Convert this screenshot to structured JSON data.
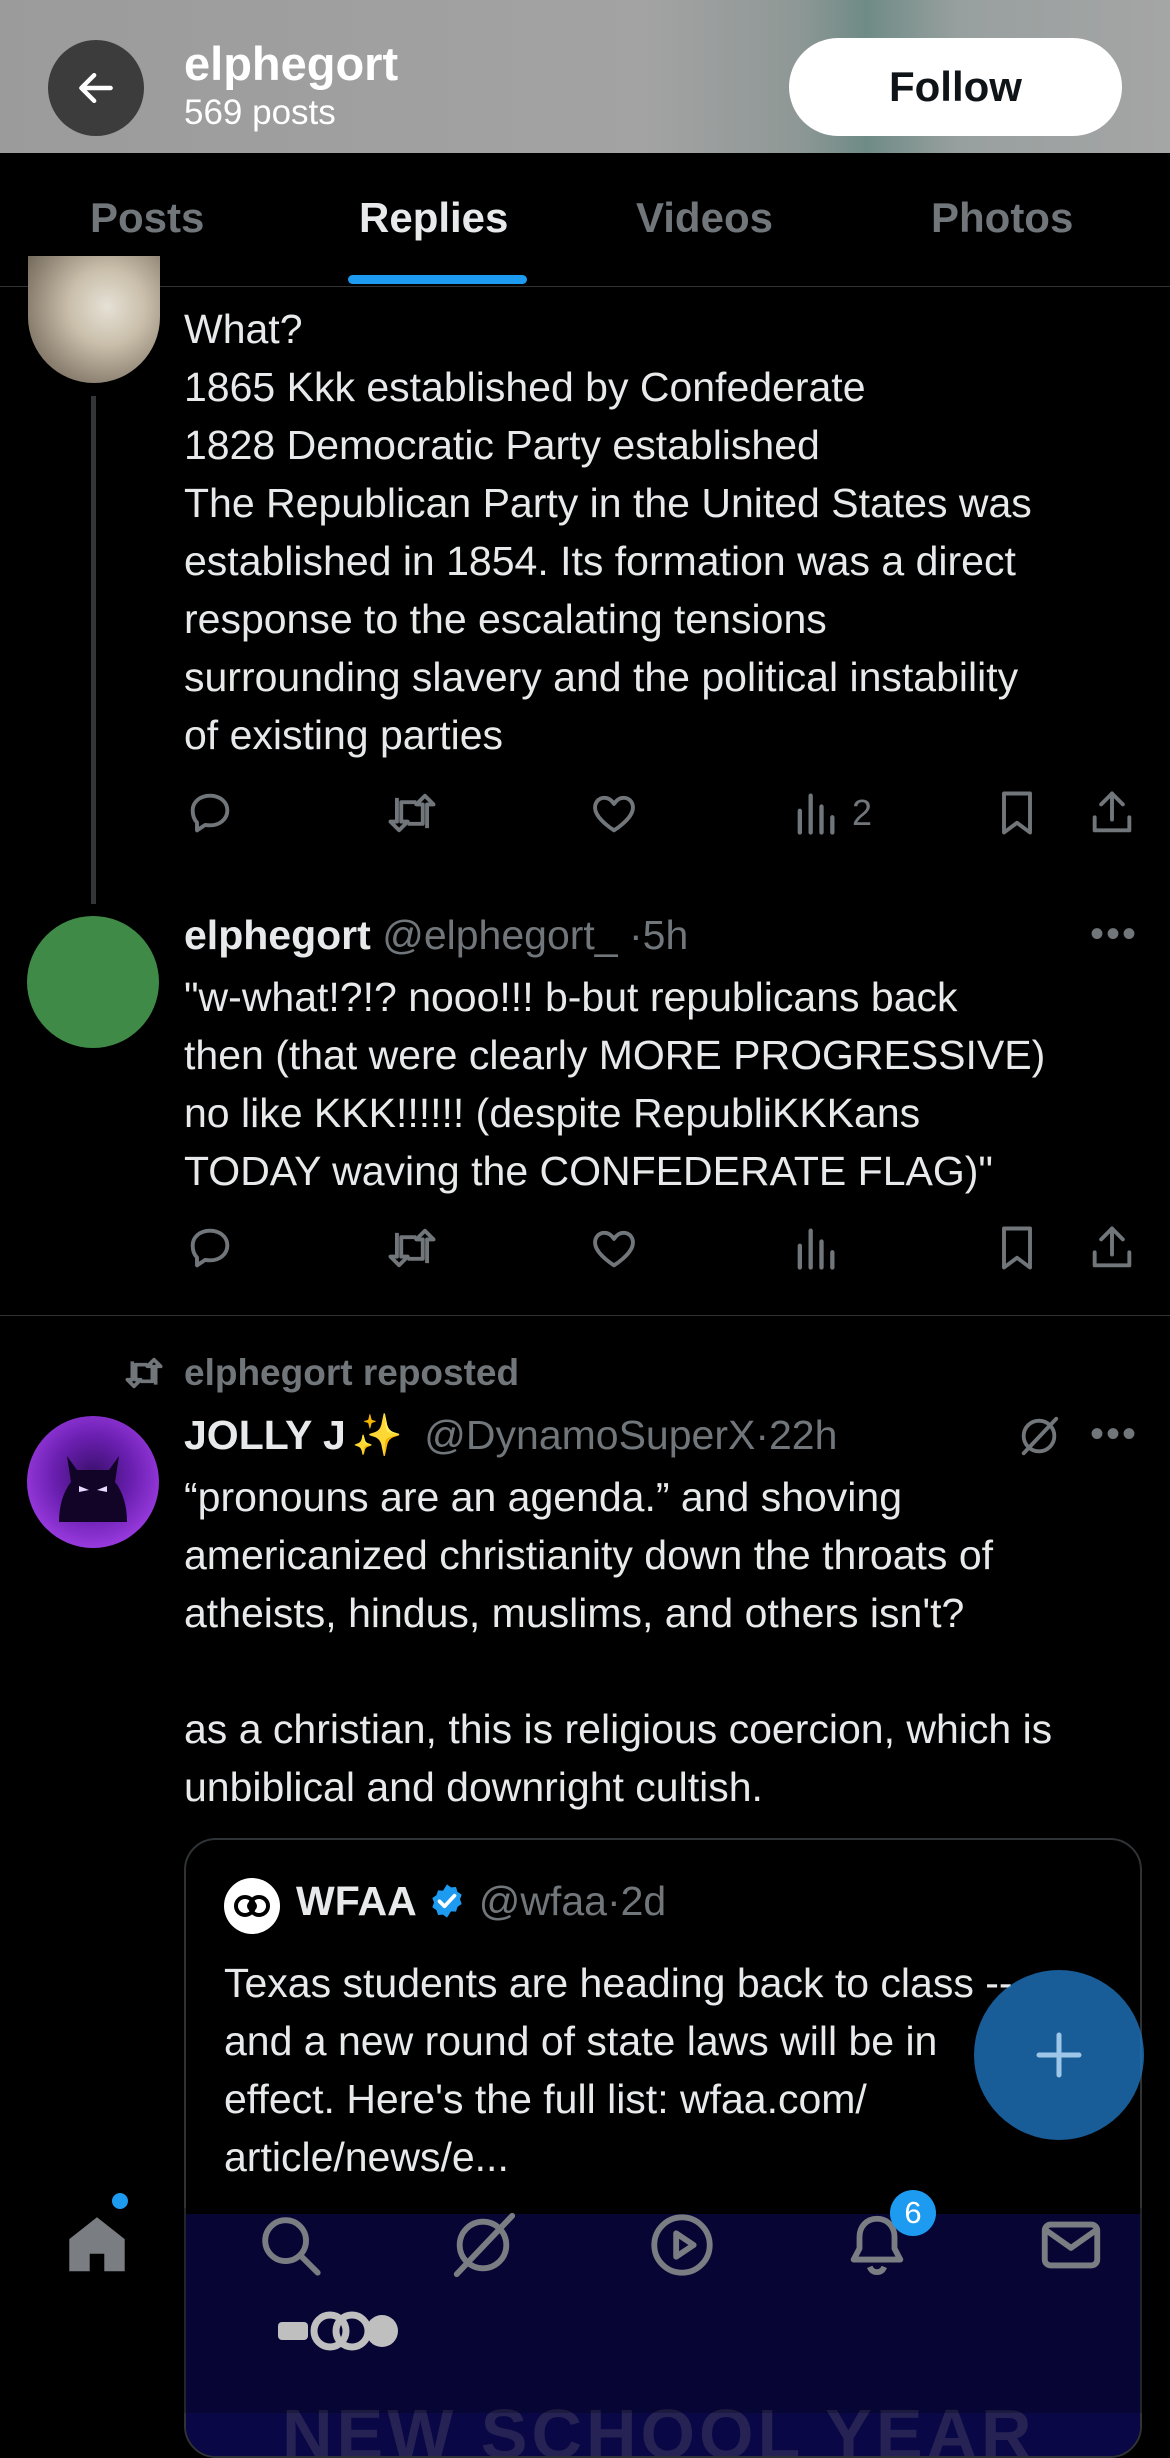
{
  "header": {
    "name": "elphegort",
    "posts_count": "569 posts",
    "follow_label": "Follow"
  },
  "tabs": [
    {
      "label": "Posts",
      "active": false
    },
    {
      "label": "Replies",
      "active": true
    },
    {
      "label": "Videos",
      "active": false
    },
    {
      "label": "Photos",
      "active": false
    }
  ],
  "post1": {
    "text": "What?\n1865 Kkk established by Confederate\n1828 Democratic Party established\nThe Republican Party in the United States was\nestablished in 1854. Its formation was a direct\nresponse to the escalating tensions\nsurrounding slavery and the political instability\nof existing parties",
    "views": "2"
  },
  "post2": {
    "name": "elphegort",
    "handle": "@elphegort_",
    "time": "5h",
    "text": "\"w-what!?!? nooo!!! b-but republicans back\nthen (that were clearly MORE PROGRESSIVE)\nno like KKK!!!!!! (despite RepubliKKKans\nTODAY waving the CONFEDERATE FLAG)\""
  },
  "post3": {
    "repost_label": "elphegort reposted",
    "name": "JOLLY J",
    "name_emoji": "✨",
    "handle": "@DynamoSuperX",
    "time": "22h",
    "text": "“pronouns are an agenda.” and shoving\namericanized christianity down the throats of\natheists, hindus, muslims, and others isn't?\n\nas a christian, this is religious coercion, which is\nunbiblical and downright cultish."
  },
  "quote": {
    "name": "WFAA",
    "handle": "@wfaa",
    "time": "2d",
    "text": "Texas students are heading back to class --\nand a new round of state laws will be in\neffect. Here's the full list:  wfaa.com/\narticle/news/e...",
    "image_caption": "NEW SCHOOL YEAR"
  },
  "notifications_badge": "6",
  "colors": {
    "accent": "#1d9bf0",
    "muted": "#71767b",
    "text": "#e7e9ea",
    "avatar_green": "#3f8a46"
  }
}
